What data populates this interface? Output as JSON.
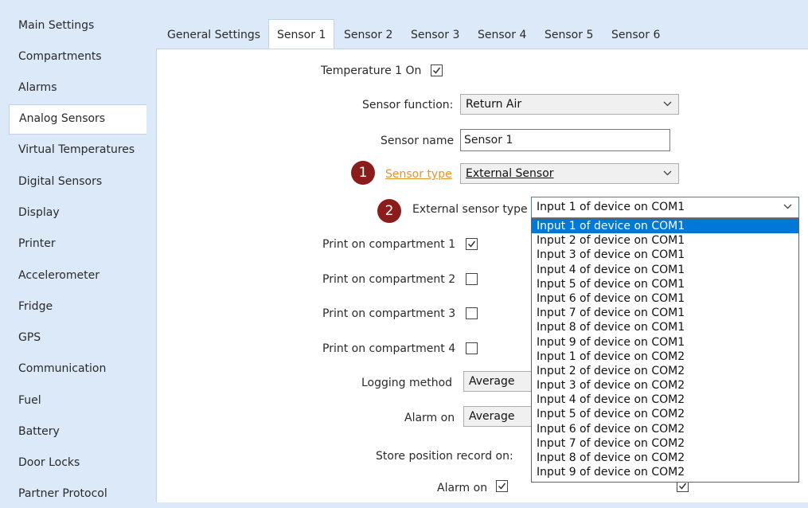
{
  "sidebar": {
    "items": [
      {
        "label": "Main Settings"
      },
      {
        "label": "Compartments"
      },
      {
        "label": "Alarms"
      },
      {
        "label": "Analog Sensors",
        "active": true
      },
      {
        "label": "Virtual Temperatures"
      },
      {
        "label": "Digital Sensors"
      },
      {
        "label": "Display"
      },
      {
        "label": "Printer"
      },
      {
        "label": "Accelerometer"
      },
      {
        "label": "Fridge"
      },
      {
        "label": "GPS"
      },
      {
        "label": "Communication"
      },
      {
        "label": "Fuel"
      },
      {
        "label": "Battery"
      },
      {
        "label": "Door Locks"
      },
      {
        "label": "Partner Protocol"
      }
    ]
  },
  "tabs": [
    {
      "label": "General Settings"
    },
    {
      "label": "Sensor 1",
      "active": true
    },
    {
      "label": "Sensor 2"
    },
    {
      "label": "Sensor 3"
    },
    {
      "label": "Sensor 4"
    },
    {
      "label": "Sensor 5"
    },
    {
      "label": "Sensor 6"
    }
  ],
  "form": {
    "temperature_on_label": "Temperature 1 On",
    "temperature_on_checked": true,
    "sensor_function_label": "Sensor function:",
    "sensor_function_value": "Return Air",
    "sensor_name_label": "Sensor name",
    "sensor_name_value": "Sensor 1",
    "sensor_type_label": "Sensor type",
    "sensor_type_value": "External Sensor",
    "external_sensor_type_label": "External sensor type",
    "external_sensor_type_value": "Input 1 of device on COM1",
    "print_compartment_1_label": "Print on compartment 1",
    "print_compartment_1_checked": true,
    "print_compartment_2_label": "Print on compartment 2",
    "print_compartment_2_checked": false,
    "print_compartment_3_label": "Print on compartment 3",
    "print_compartment_3_checked": false,
    "print_compartment_4_label": "Print on compartment 4",
    "print_compartment_4_checked": false,
    "logging_method_label": "Logging method",
    "logging_method_value": "Average",
    "alarm_on_label": "Alarm on",
    "alarm_on_value": "Average",
    "store_position_label": "Store position record on:",
    "store_alarm_on_label": "Alarm on",
    "store_alarm_on_checked": true
  },
  "annotations": {
    "badge_1": "1",
    "badge_2": "2"
  },
  "dropdown": {
    "selected_index": 0,
    "options": [
      "Input 1 of device on COM1",
      "Input 2 of device on COM1",
      "Input 3 of device on COM1",
      "Input 4 of device on COM1",
      "Input 5 of device on COM1",
      "Input 6 of device on COM1",
      "Input 7 of device on COM1",
      "Input 8 of device on COM1",
      "Input 9 of device on COM1",
      "Input 1 of device on COM2",
      "Input 2 of device on COM2",
      "Input 3 of device on COM2",
      "Input 4 of device on COM2",
      "Input 5 of device on COM2",
      "Input 6 of device on COM2",
      "Input 7 of device on COM2",
      "Input 8 of device on COM2",
      "Input 9 of device on COM2"
    ]
  },
  "colors": {
    "sidebar_bg": "#dbe9f9",
    "selection": "#0078d7",
    "link": "#e2952a",
    "badge": "#8b1c1c"
  }
}
